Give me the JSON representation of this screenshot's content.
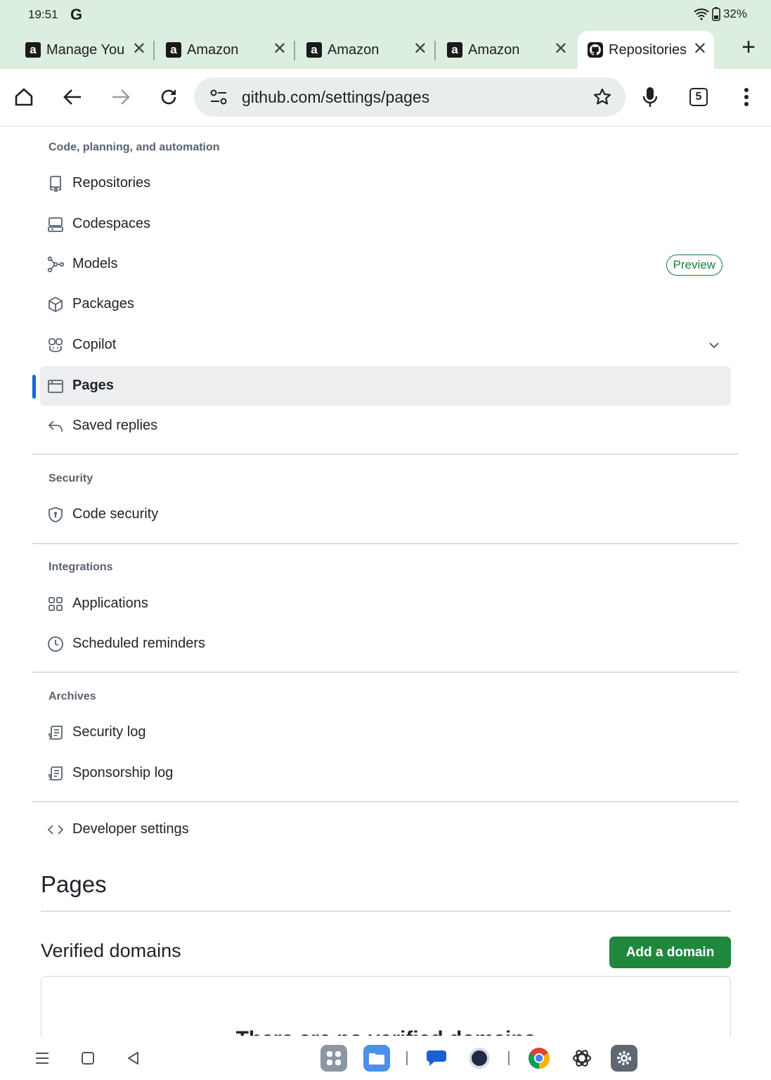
{
  "status_bar": {
    "time": "19:51",
    "google_glyph": "G",
    "battery": "32%"
  },
  "tabs": [
    {
      "title": "Manage Your",
      "favicon": "amazon-a",
      "active": false
    },
    {
      "title": "Amazon",
      "favicon": "amazon-a",
      "active": false
    },
    {
      "title": "Amazon",
      "favicon": "amazon-a",
      "active": false
    },
    {
      "title": "Amazon",
      "favicon": "amazon-a",
      "active": false
    },
    {
      "title": "Repositories",
      "favicon": "github",
      "active": true
    }
  ],
  "toolbar": {
    "url": "github.com/settings/pages",
    "tab_count": "5"
  },
  "sidebar": {
    "code_heading": "Code, planning, and automation",
    "code_items": [
      {
        "label": "Repositories",
        "icon": "repo-icon"
      },
      {
        "label": "Codespaces",
        "icon": "codespaces-icon"
      },
      {
        "label": "Models",
        "icon": "models-icon",
        "badge": "Preview"
      },
      {
        "label": "Packages",
        "icon": "package-icon"
      },
      {
        "label": "Copilot",
        "icon": "copilot-icon",
        "expandable": true
      },
      {
        "label": "Pages",
        "icon": "browser-icon",
        "selected": true
      },
      {
        "label": "Saved replies",
        "icon": "reply-icon"
      }
    ],
    "security_heading": "Security",
    "security_items": [
      {
        "label": "Code security",
        "icon": "shield-icon"
      }
    ],
    "integrations_heading": "Integrations",
    "integrations_items": [
      {
        "label": "Applications",
        "icon": "apps-icon"
      },
      {
        "label": "Scheduled reminders",
        "icon": "clock-icon"
      }
    ],
    "archives_heading": "Archives",
    "archives_items": [
      {
        "label": "Security log",
        "icon": "log-icon"
      },
      {
        "label": "Sponsorship log",
        "icon": "log-icon"
      }
    ],
    "developer_settings": "Developer settings"
  },
  "main": {
    "title": "Pages",
    "verified_domains_heading": "Verified domains",
    "add_domain_button": "Add a domain",
    "empty_state_text": "There are no verified domains"
  },
  "colors": {
    "accent_blue": "#0969da",
    "primary_green": "#1f883d",
    "chrome_tint": "#dceee0"
  }
}
